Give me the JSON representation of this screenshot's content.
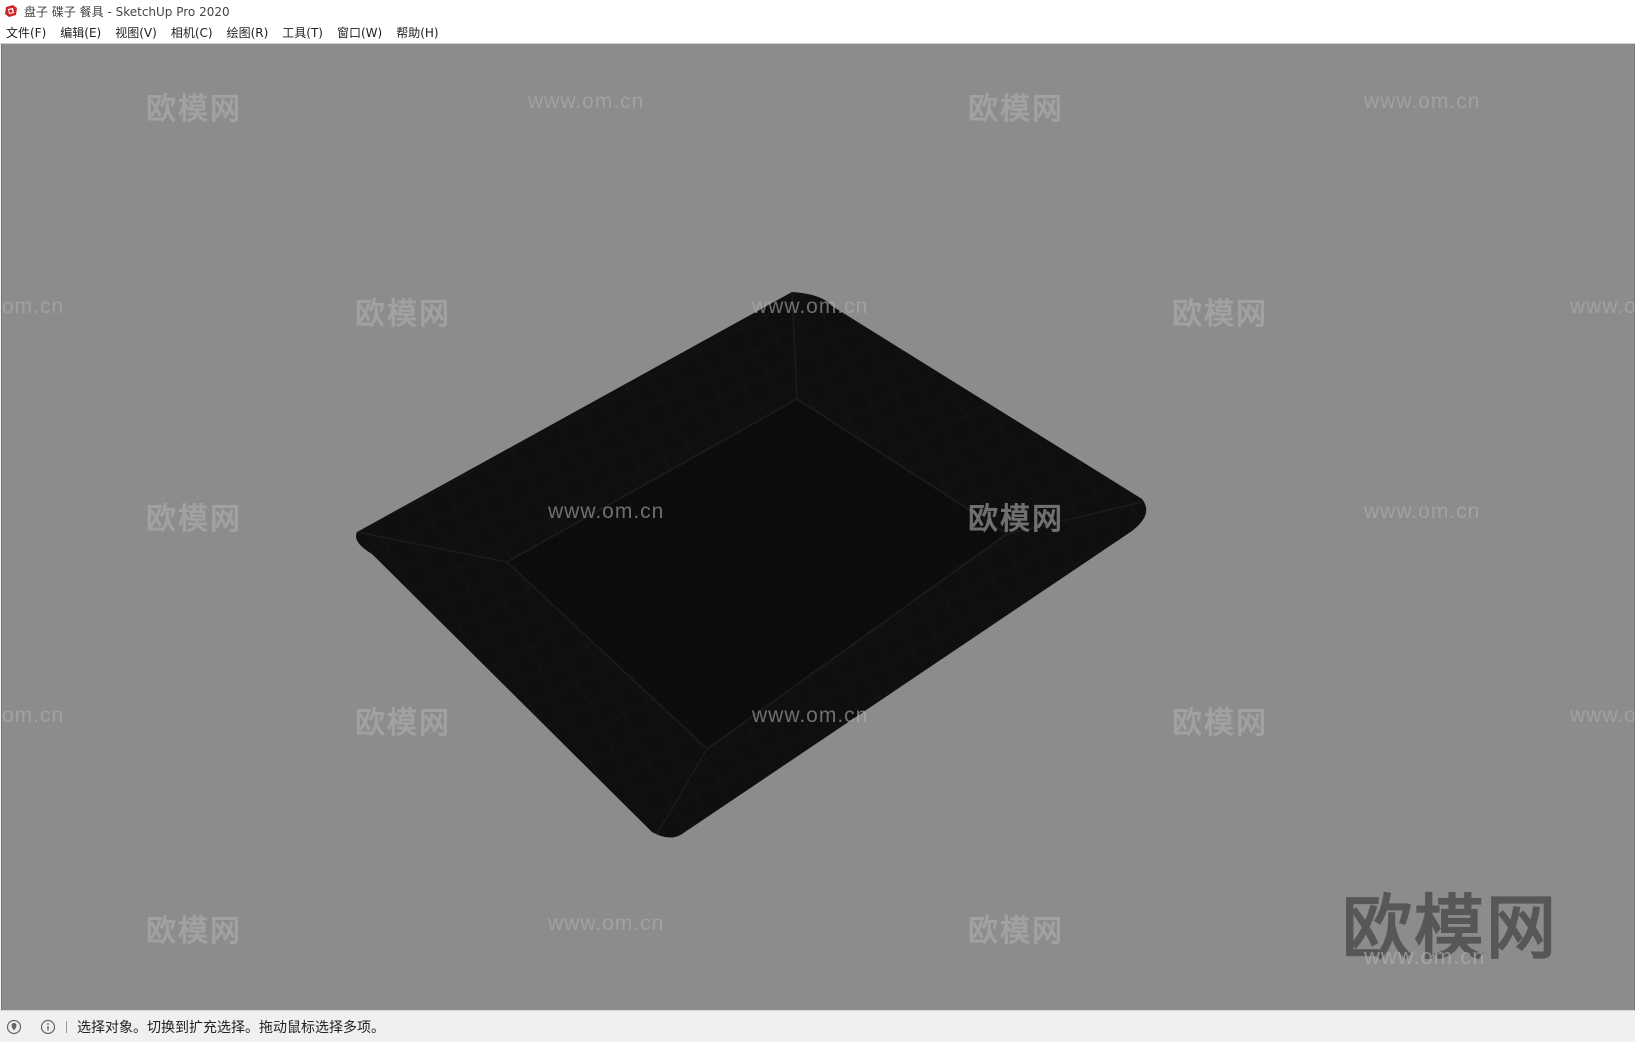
{
  "window": {
    "title": "盘子 碟子 餐具 - SketchUp Pro 2020"
  },
  "menu": {
    "items": [
      {
        "label": "文件(F)"
      },
      {
        "label": "编辑(E)"
      },
      {
        "label": "视图(V)"
      },
      {
        "label": "相机(C)"
      },
      {
        "label": "绘图(R)"
      },
      {
        "label": "工具(T)"
      },
      {
        "label": "窗口(W)"
      },
      {
        "label": "帮助(H)"
      }
    ]
  },
  "viewport": {
    "background_color": "#8c8c8c",
    "model_color": "#0f0f0f",
    "watermark": {
      "logo_text": "欧模网",
      "url_text": "www.om.cn",
      "url_partial_left": "om.cn",
      "url_partial_right": "www.o"
    }
  },
  "status": {
    "message": "选择对象。切换到扩充选择。拖动鼠标选择多项。",
    "icons": [
      "geo-location-icon",
      "info-icon"
    ]
  }
}
